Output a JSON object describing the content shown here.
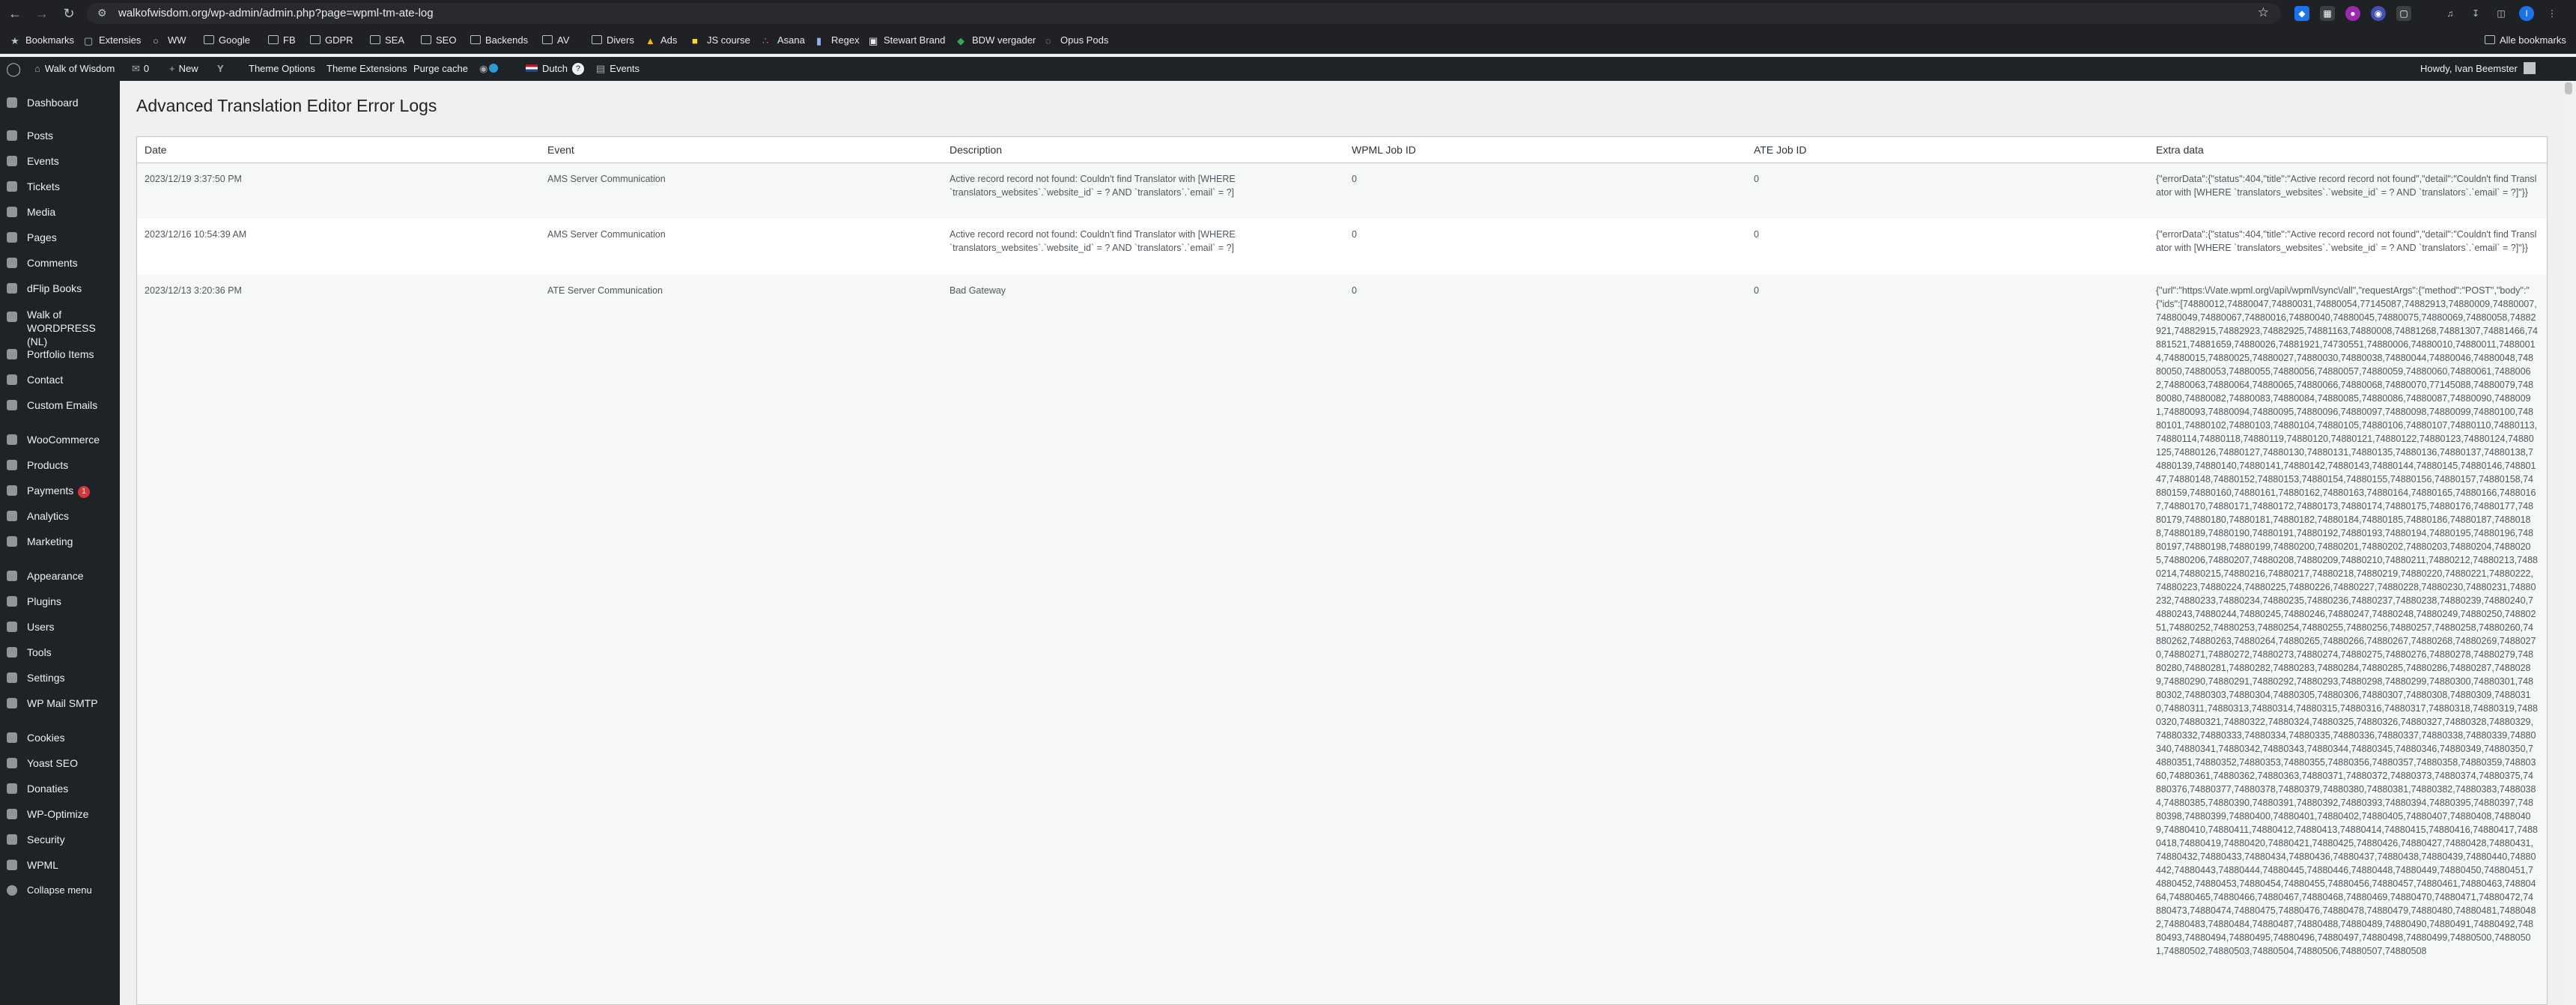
{
  "browser": {
    "url": "walkofwisdom.org/wp-admin/admin.php?page=wpml-tm-ate-log",
    "bookmarks": [
      "Bookmarks",
      "Extensies",
      "WW",
      "Google",
      "FB",
      "GDPR",
      "SEA",
      "SEO",
      "Backends",
      "AV",
      "Divers",
      "Ads",
      "JS course",
      "Asana",
      "Regex",
      "Stewart Brand",
      "BDW vergader",
      "Opus Pods"
    ],
    "all_bookmarks": "Alle bookmarks"
  },
  "adminbar": {
    "site_name": "Walk of Wisdom",
    "comments_count": "0",
    "new_label": "New",
    "theme_options": "Theme Options",
    "theme_extensions": "Theme Extensions",
    "purge_cache": "Purge cache",
    "language": "Dutch",
    "language_badge": "?",
    "events": "Events",
    "howdy": "Howdy, Ivan Beemster"
  },
  "sidebar": {
    "items": [
      {
        "label": "Dashboard",
        "icon": "dashboard-icon"
      },
      {
        "label": "Posts",
        "icon": "pin-icon"
      },
      {
        "label": "Events",
        "icon": "calendar-icon"
      },
      {
        "label": "Tickets",
        "icon": "ticket-icon"
      },
      {
        "label": "Media",
        "icon": "media-icon"
      },
      {
        "label": "Pages",
        "icon": "page-icon"
      },
      {
        "label": "Comments",
        "icon": "comment-icon"
      },
      {
        "label": "dFlip Books",
        "icon": "book-icon"
      },
      {
        "label": "Walk of WORDPRESS (NL)",
        "icon": "house-icon"
      },
      {
        "label": "Portfolio Items",
        "icon": "portfolio-icon"
      },
      {
        "label": "Contact",
        "icon": "mail-icon"
      },
      {
        "label": "Custom Emails",
        "icon": "email-icon"
      },
      {
        "label": "WooCommerce",
        "icon": "woo-icon"
      },
      {
        "label": "Products",
        "icon": "product-icon"
      },
      {
        "label": "Payments",
        "icon": "payments-icon",
        "badge": "1"
      },
      {
        "label": "Analytics",
        "icon": "analytics-icon"
      },
      {
        "label": "Marketing",
        "icon": "megaphone-icon"
      },
      {
        "label": "Appearance",
        "icon": "brush-icon"
      },
      {
        "label": "Plugins",
        "icon": "plugin-icon"
      },
      {
        "label": "Users",
        "icon": "user-icon"
      },
      {
        "label": "Tools",
        "icon": "wrench-icon"
      },
      {
        "label": "Settings",
        "icon": "settings-icon"
      },
      {
        "label": "WP Mail SMTP",
        "icon": "smtp-icon"
      },
      {
        "label": "Cookies",
        "icon": "cookie-icon"
      },
      {
        "label": "Yoast SEO",
        "icon": "yoast-icon"
      },
      {
        "label": "Donaties",
        "icon": "heart-icon"
      },
      {
        "label": "WP-Optimize",
        "icon": "optimize-icon"
      },
      {
        "label": "Security",
        "icon": "shield-icon"
      },
      {
        "label": "WPML",
        "icon": "wpml-icon"
      },
      {
        "label": "Collapse menu",
        "icon": "collapse-icon"
      }
    ]
  },
  "page": {
    "title": "Advanced Translation Editor Error Logs",
    "columns": [
      "Date",
      "Event",
      "Description",
      "WPML Job ID",
      "ATE Job ID",
      "Extra data"
    ],
    "rows": [
      {
        "date": "2023/12/19 3:37:50 PM",
        "event": "AMS Server Communication",
        "description": "Active record record not found: Couldn't find Translator with [WHERE `translators_websites`.`website_id` = ? AND `translators`.`email` = ?]",
        "wpml_job_id": "0",
        "ate_job_id": "0",
        "extra": "{\"errorData\":{\"status\":404,\"title\":\"Active record record not found\",\"detail\":\"Couldn't find Translator with [WHERE `translators_websites`.`website_id` = ? AND `translators`.`email` = ?]\"}}"
      },
      {
        "date": "2023/12/16 10:54:39 AM",
        "event": "AMS Server Communication",
        "description": "Active record record not found: Couldn't find Translator with [WHERE `translators_websites`.`website_id` = ? AND `translators`.`email` = ?]",
        "wpml_job_id": "0",
        "ate_job_id": "0",
        "extra": "{\"errorData\":{\"status\":404,\"title\":\"Active record record not found\",\"detail\":\"Couldn't find Translator with [WHERE `translators_websites`.`website_id` = ? AND `translators`.`email` = ?]\"}}"
      },
      {
        "date": "2023/12/13 3:20:36 PM",
        "event": "ATE Server Communication",
        "description": "Bad Gateway",
        "wpml_job_id": "0",
        "ate_job_id": "0",
        "extra": "{\"url\":\"https:\\/\\/ate.wpml.org\\/api\\/wpml\\/sync\\/all\",\"requestArgs\":{\"method\":\"POST\",\"body\":\"{\"ids\":[74880012,74880047,74880031,74880054,77145087,74882913,74880009,74880007,74880049,74880067,74880016,74880040,74880045,74880075,74880069,74880058,74882921,74882915,74882923,74882925,74881163,74880008,74881268,74881307,74881466,74881521,74881659,74880026,74881921,74730551,74880006,74880010,74880011,74880014,74880015,74880025,74880027,74880030,74880038,74880044,74880046,74880048,74880050,74880053,74880055,74880056,74880057,74880059,74880060,74880061,74880062,74880063,74880064,74880065,74880066,74880068,74880070,77145088,74880079,74880080,74880082,74880083,74880084,74880085,74880086,74880087,74880090,74880091,74880093,74880094,74880095,74880096,74880097,74880098,74880099,74880100,74880101,74880102,74880103,74880104,74880105,74880106,74880107,74880110,74880113,74880114,74880118,74880119,74880120,74880121,74880122,74880123,74880124,74880125,74880126,74880127,74880130,74880131,74880135,74880136,74880137,74880138,74880139,74880140,74880141,74880142,74880143,74880144,74880145,74880146,74880147,74880148,74880152,74880153,74880154,74880155,74880156,74880157,74880158,74880159,74880160,74880161,74880162,74880163,74880164,74880165,74880166,74880167,74880170,74880171,74880172,74880173,74880174,74880175,74880176,74880177,74880179,74880180,74880181,74880182,74880184,74880185,74880186,74880187,74880188,74880189,74880190,74880191,74880192,74880193,74880194,74880195,74880196,74880197,74880198,74880199,74880200,74880201,74880202,74880203,74880204,74880205,74880206,74880207,74880208,74880209,74880210,74880211,74880212,74880213,74880214,74880215,74880216,74880217,74880218,74880219,74880220,74880221,74880222,74880223,74880224,74880225,74880226,74880227,74880228,74880230,74880231,74880232,74880233,74880234,74880235,74880236,74880237,74880238,74880239,74880240,74880243,74880244,74880245,74880246,74880247,74880248,74880249,74880250,74880251,74880252,74880253,74880254,74880255,74880256,74880257,74880258,74880260,74880262,74880263,74880264,74880265,74880266,74880267,74880268,74880269,74880270,74880271,74880272,74880273,74880274,74880275,74880276,74880278,74880279,74880280,74880281,74880282,74880283,74880284,74880285,74880286,74880287,74880289,74880290,74880291,74880292,74880293,74880298,74880299,74880300,74880301,74880302,74880303,74880304,74880305,74880306,74880307,74880308,74880309,74880310,74880311,74880313,74880314,74880315,74880316,74880317,74880318,74880319,74880320,74880321,74880322,74880324,74880325,74880326,74880327,74880328,74880329,74880332,74880333,74880334,74880335,74880336,74880337,74880338,74880339,74880340,74880341,74880342,74880343,74880344,74880345,74880346,74880349,74880350,74880351,74880352,74880353,74880355,74880356,74880357,74880358,74880359,74880360,74880361,74880362,74880363,74880371,74880372,74880373,74880374,74880375,74880376,74880377,74880378,74880379,74880380,74880381,74880382,74880383,74880384,74880385,74880390,74880391,74880392,74880393,74880394,74880395,74880397,74880398,74880399,74880400,74880401,74880402,74880405,74880407,74880408,74880409,74880410,74880411,74880412,74880413,74880414,74880415,74880416,74880417,74880418,74880419,74880420,74880421,74880425,74880426,74880427,74880428,74880431,74880432,74880433,74880434,74880436,74880437,74880438,74880439,74880440,74880442,74880443,74880444,74880445,74880446,74880448,74880449,74880450,74880451,74880452,74880453,74880454,74880455,74880456,74880457,74880461,74880463,74880464,74880465,74880466,74880467,74880468,74880469,74880470,74880471,74880472,74880473,74880474,74880475,74880476,74880478,74880479,74880480,74880481,74880482,74880483,74880484,74880487,74880488,74880489,74880490,74880491,74880492,74880493,74880494,74880495,74880496,74880497,74880498,74880499,74880500,74880501,74880502,74880503,74880504,74880506,74880507,74880508"
      }
    ]
  },
  "colors": {
    "browser_bg": "#202124",
    "admin_bg": "#1d2327",
    "content_bg": "#f0f0f1",
    "menu_text": "#f0f0f1",
    "badge": "#d63638",
    "wpml_badge": "#2b9bd6"
  }
}
